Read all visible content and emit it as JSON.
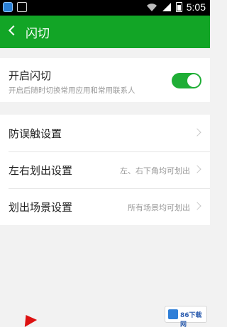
{
  "status_bar": {
    "time": "5:05"
  },
  "app_bar": {
    "title": "闪切"
  },
  "toggle_card": {
    "title": "开启闪切",
    "description": "开启后随时切换常用应用和常用联系人",
    "enabled": true
  },
  "settings": [
    {
      "label": "防误触设置",
      "value": ""
    },
    {
      "label": "左右划出设置",
      "value": "左、右下角均可划出"
    },
    {
      "label": "划出场景设置",
      "value": "所有场景均可划出"
    }
  ],
  "watermark": {
    "text": "86下载网"
  },
  "colors": {
    "brand_green": "#12a526",
    "switch_on": "#1fae36"
  }
}
